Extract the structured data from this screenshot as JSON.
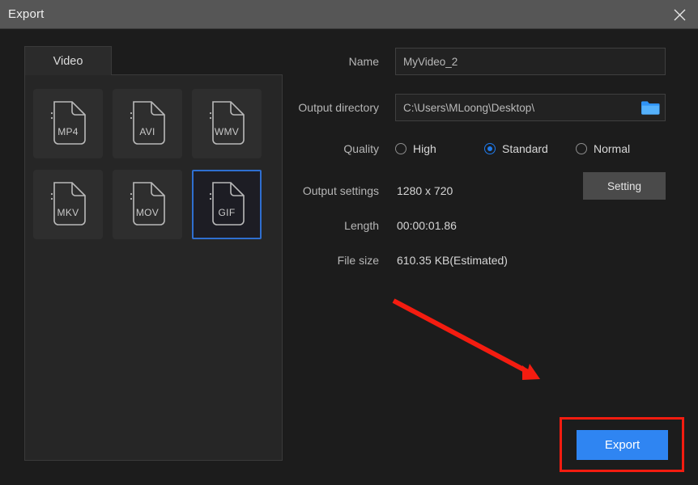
{
  "window": {
    "title": "Export",
    "close_icon": "close-icon"
  },
  "tabs": [
    {
      "label": "Video",
      "active": true
    }
  ],
  "formats": [
    {
      "label": "MP4",
      "selected": false
    },
    {
      "label": "AVI",
      "selected": false
    },
    {
      "label": "WMV",
      "selected": false
    },
    {
      "label": "MKV",
      "selected": false
    },
    {
      "label": "MOV",
      "selected": false
    },
    {
      "label": "GIF",
      "selected": true
    }
  ],
  "form": {
    "name": {
      "label": "Name",
      "value": "MyVideo_2"
    },
    "output_directory": {
      "label": "Output directory",
      "value": "C:\\Users\\MLoong\\Desktop\\",
      "browse_icon": "folder-icon"
    },
    "quality": {
      "label": "Quality",
      "options": [
        {
          "label": "High",
          "selected": false
        },
        {
          "label": "Standard",
          "selected": true
        },
        {
          "label": "Normal",
          "selected": false
        }
      ]
    },
    "output_settings": {
      "label": "Output settings",
      "value": "1280 x 720",
      "button_label": "Setting"
    },
    "length": {
      "label": "Length",
      "value": "00:00:01.86"
    },
    "file_size": {
      "label": "File size",
      "value": "610.35 KB(Estimated)"
    }
  },
  "actions": {
    "export_label": "Export"
  },
  "colors": {
    "accent_blue": "#2f85f2",
    "selection_border": "#2f6fd0",
    "annotation_red": "#f41c10",
    "titlebar": "#565656",
    "window_bg": "#1c1c1c",
    "panel_bg": "#262626"
  },
  "annotations": [
    {
      "name": "arrow-to-gif-tile",
      "color": "#f41c10"
    },
    {
      "name": "arrow-to-export-button",
      "color": "#f41c10"
    },
    {
      "name": "highlight-box-export-button",
      "color": "#f41c10"
    }
  ]
}
